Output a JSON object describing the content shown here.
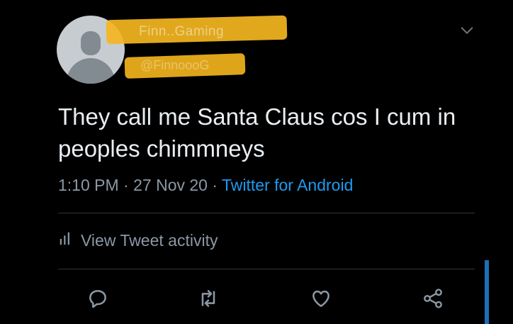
{
  "author": {
    "display_name": "Finn..Gaming",
    "handle": "@FinnoooG",
    "avatar_icon": "default-avatar-icon"
  },
  "tweet": {
    "text": "They call me Santa Claus cos I cum in peoples chimmneys",
    "time": "1:10 PM",
    "date": "27 Nov 20",
    "source": "Twitter for Android"
  },
  "activity": {
    "label": "View Tweet activity",
    "icon": "bar-chart-icon"
  },
  "actions": [
    "reply-icon",
    "retweet-icon",
    "like-icon",
    "share-icon"
  ],
  "colors": {
    "background": "#000000",
    "text": "#e9eef2",
    "muted": "#8b98a5",
    "accent": "#1d9bf0",
    "redaction": "#f4b621"
  }
}
